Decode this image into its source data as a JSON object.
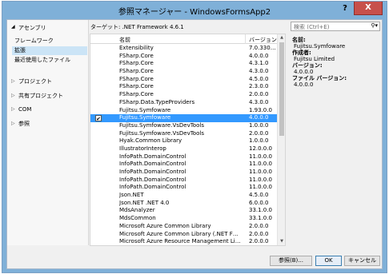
{
  "window": {
    "title": "参照マネージャー - WindowsFormsApp2",
    "help_label": "?",
    "close_label": "X"
  },
  "left": {
    "assembly_header": "アセンブリ",
    "assembly_items": [
      "フレームワーク",
      "拡張",
      "最近使用したファイル"
    ],
    "nodes": [
      "プロジェクト",
      "共有プロジェクト",
      "COM",
      "参照"
    ]
  },
  "target": "ターゲット: .NET Framework 4.6.1",
  "table": {
    "col_name": "名前",
    "col_version": "バージョン",
    "rows": [
      {
        "name": "Extensibility",
        "version": "7.0.330…",
        "checked": false,
        "selected": false
      },
      {
        "name": "FSharp.Core",
        "version": "4.0.0.0",
        "checked": false,
        "selected": false
      },
      {
        "name": "FSharp.Core",
        "version": "4.3.1.0",
        "checked": false,
        "selected": false
      },
      {
        "name": "FSharp.Core",
        "version": "4.3.0.0",
        "checked": false,
        "selected": false
      },
      {
        "name": "FSharp.Core",
        "version": "4.5.0.0",
        "checked": false,
        "selected": false
      },
      {
        "name": "FSharp.Core",
        "version": "2.3.0.0",
        "checked": false,
        "selected": false
      },
      {
        "name": "FSharp.Core",
        "version": "2.0.0.0",
        "checked": false,
        "selected": false
      },
      {
        "name": "FSharp.Data.TypeProviders",
        "version": "4.3.0.0",
        "checked": false,
        "selected": false
      },
      {
        "name": "Fujitsu.Symfoware",
        "version": "1.93.0.0",
        "checked": false,
        "selected": false
      },
      {
        "name": "Fujitsu.Symfoware",
        "version": "4.0.0.0",
        "checked": true,
        "selected": true
      },
      {
        "name": "Fujitsu.Symfoware.VsDevTools",
        "version": "1.0.0.0",
        "checked": false,
        "selected": false
      },
      {
        "name": "Fujitsu.Symfoware.VsDevTools",
        "version": "2.0.0.0",
        "checked": false,
        "selected": false
      },
      {
        "name": "Hyak.Common Library",
        "version": "1.0.0.0",
        "checked": false,
        "selected": false
      },
      {
        "name": "IllustratorInterop",
        "version": "12.0.0.0",
        "checked": false,
        "selected": false
      },
      {
        "name": "InfoPath.DomainControl",
        "version": "11.0.0.0",
        "checked": false,
        "selected": false
      },
      {
        "name": "InfoPath.DomainControl",
        "version": "11.0.0.0",
        "checked": false,
        "selected": false
      },
      {
        "name": "InfoPath.DomainControl",
        "version": "11.0.0.0",
        "checked": false,
        "selected": false
      },
      {
        "name": "InfoPath.DomainControl",
        "version": "11.0.0.0",
        "checked": false,
        "selected": false
      },
      {
        "name": "InfoPath.DomainControl",
        "version": "11.0.0.0",
        "checked": false,
        "selected": false
      },
      {
        "name": "Json.NET",
        "version": "4.5.0.0",
        "checked": false,
        "selected": false
      },
      {
        "name": "Json.NET .NET 4.0",
        "version": "6.0.0.0",
        "checked": false,
        "selected": false
      },
      {
        "name": "MdsAnalyzer",
        "version": "33.1.0.0",
        "checked": false,
        "selected": false
      },
      {
        "name": "MdsCommon",
        "version": "33.1.0.0",
        "checked": false,
        "selected": false
      },
      {
        "name": "Microsoft Azure Common Library",
        "version": "2.0.0.0",
        "checked": false,
        "selected": false
      },
      {
        "name": "Microsoft Azure Common Library (.NET F…",
        "version": "2.0.0.0",
        "checked": false,
        "selected": false
      },
      {
        "name": "Microsoft Azure Resource Management Li…",
        "version": "2.0.0.0",
        "checked": false,
        "selected": false
      }
    ]
  },
  "search": {
    "placeholder": "検索 (Ctrl+E)",
    "icon": "search-icon"
  },
  "details": [
    {
      "key": "名前:",
      "value": "Fujitsu.Symfoware"
    },
    {
      "key": "作成者:",
      "value": "Fujitsu Limited"
    },
    {
      "key": "バージョン:",
      "value": "4.0.0.0"
    },
    {
      "key": "ファイル バージョン:",
      "value": "4.0.0.0"
    }
  ],
  "buttons": {
    "browse": "参照(B)...",
    "ok": "OK",
    "cancel": "キャンセル"
  },
  "colors": {
    "selection": "#3399ff",
    "title_bar": "#7fb0d8",
    "close_button": "#c7504b"
  }
}
